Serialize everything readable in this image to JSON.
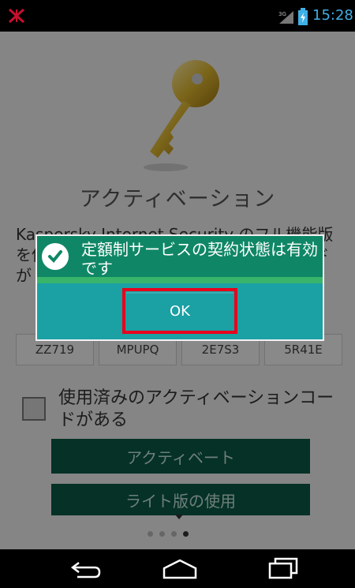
{
  "status_bar": {
    "time": "15:28",
    "network_label": "3G",
    "app_icon": "kaspersky-logo-icon",
    "time_color": "#3fb0e6"
  },
  "screen": {
    "title": "アクティベーション",
    "description": "Kaspersky Internet Security のフル機能版を使用するには、アクティベーションコードが",
    "code_fields": [
      "ZZ719",
      "MPUPQ",
      "2E7S3",
      "5R41E"
    ],
    "checkbox_label": "使用済みのアクティベーションコードがある",
    "activate_button": "アクティベート",
    "lite_button": "ライト版の使用",
    "page_indicator": {
      "total": 4,
      "active": 4
    }
  },
  "dialog": {
    "message": "定額制サービスの契約状態は有効です",
    "ok_button": "OK",
    "icon": "check-circle-icon",
    "colors": {
      "body": "#1ba0a4",
      "header": "#0f8766",
      "highlight": "#e8001c"
    }
  },
  "nav_bar": {
    "back_icon": "back-icon",
    "home_icon": "home-icon",
    "recent_icon": "recent-apps-icon"
  }
}
